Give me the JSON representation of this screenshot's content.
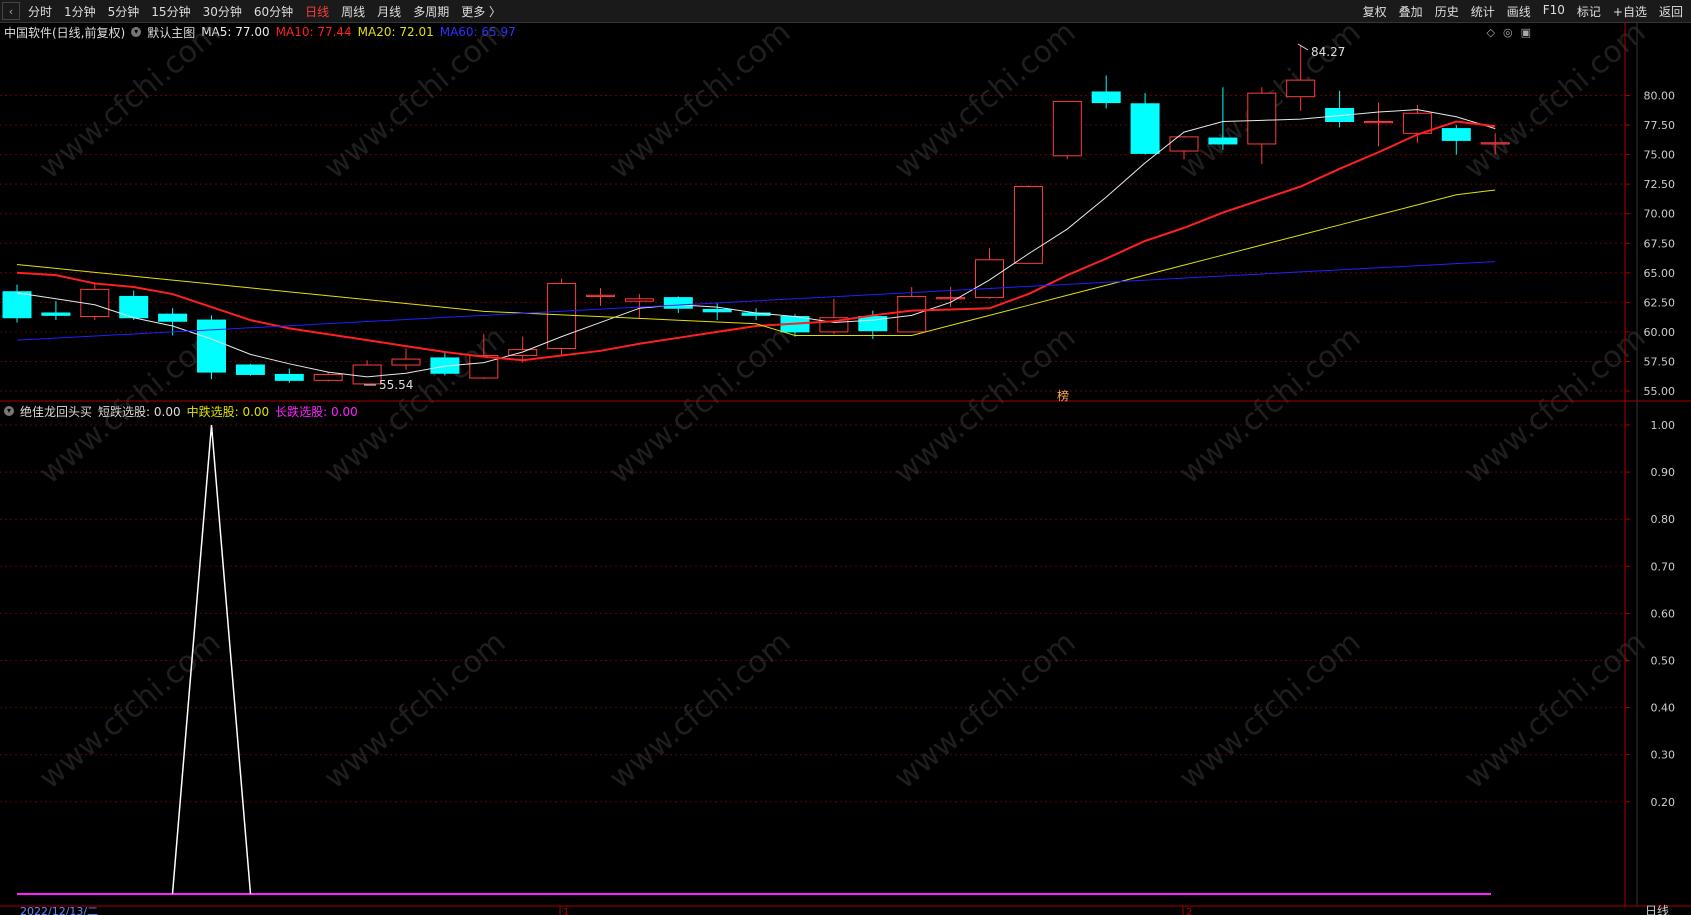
{
  "toolbar": {
    "periods": [
      "分时",
      "1分钟",
      "5分钟",
      "15分钟",
      "30分钟",
      "60分钟",
      "日线",
      "周线",
      "月线",
      "多周期",
      "更多 〉"
    ],
    "active_period": "日线",
    "right_items": [
      "复权",
      "叠加",
      "历史",
      "统计",
      "画线",
      "F10",
      "标记",
      "+自选",
      "返回"
    ]
  },
  "main_chart": {
    "title": "中国软件(日线,前复权)",
    "indicator_name": "默认主图",
    "ma5": "MA5: 77.00",
    "ma10": "MA10: 77.44",
    "ma20": "MA20: 72.01",
    "ma60": "MA60: 65.97",
    "high_label": "84.27",
    "low_label": "55.54",
    "marker_label": "榜",
    "y_ticks": [
      "80.00",
      "77.50",
      "75.00",
      "72.50",
      "70.00",
      "67.50",
      "65.00",
      "62.50",
      "60.00",
      "57.50",
      "55.00"
    ]
  },
  "sub_chart": {
    "name": "绝佳龙回头买",
    "short": "短跌选股: 0.00",
    "mid": "中跌选股: 0.00",
    "long": "长跌选股: 0.00",
    "y_ticks": [
      "1.00",
      "0.90",
      "0.80",
      "0.70",
      "0.60",
      "0.50",
      "0.40",
      "0.30",
      "0.20"
    ]
  },
  "bottom": {
    "date": "2022/12/13/二",
    "period_label": "日线",
    "month_marks": [
      "1",
      "2"
    ]
  },
  "colors": {
    "up": "#ff3c3c",
    "down": "#00ffff",
    "ma5": "#e8e8e8",
    "ma10": "#ff2020",
    "ma20": "#e0e000",
    "ma60": "#2020ff",
    "short": "#ffffff",
    "mid": "#e0e000",
    "long": "#ff20ff",
    "grid": "#6a0000"
  },
  "watermark": "www.cfchi.com",
  "chart_data": [
    {
      "type": "candlestick",
      "name": "中国软件(日线,前复权)",
      "ylim": [
        54,
        84.5
      ],
      "candles": [
        {
          "o": 63.4,
          "c": 61.2,
          "h": 64.0,
          "l": 60.8
        },
        {
          "o": 61.6,
          "c": 61.4,
          "h": 62.6,
          "l": 61.0
        },
        {
          "o": 61.3,
          "c": 63.6,
          "h": 64.2,
          "l": 61.0
        },
        {
          "o": 63.0,
          "c": 61.2,
          "h": 63.5,
          "l": 61.0
        },
        {
          "o": 61.5,
          "c": 60.9,
          "h": 62.0,
          "l": 59.7
        },
        {
          "o": 61.0,
          "c": 56.6,
          "h": 61.4,
          "l": 56.0
        },
        {
          "o": 57.2,
          "c": 56.4,
          "h": 57.3,
          "l": 56.3
        },
        {
          "o": 56.4,
          "c": 55.9,
          "h": 56.9,
          "l": 55.7
        },
        {
          "o": 55.9,
          "c": 56.4,
          "h": 56.6,
          "l": 55.8
        },
        {
          "o": 55.6,
          "c": 57.2,
          "h": 57.6,
          "l": 55.5
        },
        {
          "o": 57.2,
          "c": 57.7,
          "h": 58.6,
          "l": 56.8
        },
        {
          "o": 57.8,
          "c": 56.5,
          "h": 58.3,
          "l": 56.3
        },
        {
          "o": 56.1,
          "c": 58.0,
          "h": 59.8,
          "l": 56.0
        },
        {
          "o": 58.0,
          "c": 58.5,
          "h": 59.6,
          "l": 57.4
        },
        {
          "o": 58.6,
          "c": 64.1,
          "h": 64.5,
          "l": 58.0
        },
        {
          "o": 63.0,
          "c": 63.1,
          "h": 63.7,
          "l": 62.2
        },
        {
          "o": 62.6,
          "c": 62.8,
          "h": 63.2,
          "l": 61.2
        },
        {
          "o": 62.9,
          "c": 62.0,
          "h": 63.0,
          "l": 61.6
        },
        {
          "o": 61.9,
          "c": 61.7,
          "h": 62.4,
          "l": 61.0
        },
        {
          "o": 61.6,
          "c": 61.4,
          "h": 62.0,
          "l": 61.0
        },
        {
          "o": 61.3,
          "c": 60.0,
          "h": 61.5,
          "l": 59.6
        },
        {
          "o": 60.0,
          "c": 61.2,
          "h": 62.8,
          "l": 59.8
        },
        {
          "o": 61.3,
          "c": 60.1,
          "h": 61.8,
          "l": 59.4
        },
        {
          "o": 60.0,
          "c": 63.0,
          "h": 63.8,
          "l": 60.0
        },
        {
          "o": 62.9,
          "c": 62.9,
          "h": 63.8,
          "l": 62.1
        },
        {
          "o": 62.9,
          "c": 66.1,
          "h": 67.1,
          "l": 62.8
        },
        {
          "o": 65.8,
          "c": 72.3,
          "h": 72.4,
          "l": 65.8
        },
        {
          "o": 74.9,
          "c": 79.5,
          "h": 79.5,
          "l": 74.6
        },
        {
          "o": 80.3,
          "c": 79.4,
          "h": 81.7,
          "l": 78.9
        },
        {
          "o": 79.3,
          "c": 75.1,
          "h": 80.2,
          "l": 75.0
        },
        {
          "o": 75.3,
          "c": 76.5,
          "h": 76.6,
          "l": 74.6
        },
        {
          "o": 76.4,
          "c": 75.9,
          "h": 80.7,
          "l": 75.4
        },
        {
          "o": 75.9,
          "c": 80.2,
          "h": 80.7,
          "l": 74.2
        },
        {
          "o": 79.9,
          "c": 81.3,
          "h": 84.27,
          "l": 78.7
        },
        {
          "o": 78.9,
          "c": 77.8,
          "h": 80.4,
          "l": 77.3
        },
        {
          "o": 77.7,
          "c": 77.8,
          "h": 79.4,
          "l": 75.7
        },
        {
          "o": 76.8,
          "c": 78.5,
          "h": 79.2,
          "l": 76.0
        },
        {
          "o": 77.2,
          "c": 76.2,
          "h": 77.5,
          "l": 75.0
        },
        {
          "o": 76.0,
          "c": 76.0,
          "h": 76.8,
          "l": 75.0
        }
      ],
      "ma5": [
        63.3,
        62.8,
        62.3,
        61.2,
        60.5,
        59.4,
        58.1,
        57.3,
        56.6,
        56.2,
        56.5,
        57.1,
        57.4,
        58.3,
        59.6,
        60.8,
        62.0,
        62.3,
        62.1,
        61.6,
        61.3,
        60.8,
        61.0,
        61.4,
        62.5,
        64.4,
        66.6,
        68.7,
        71.4,
        74.3,
        76.9,
        77.8,
        77.9,
        78.0,
        78.3,
        78.6,
        78.8,
        78.2,
        77.2
      ],
      "ma10": [
        65.0,
        64.8,
        64.1,
        63.8,
        63.2,
        62.1,
        61.0,
        60.3,
        59.8,
        59.3,
        58.8,
        58.3,
        57.9,
        57.6,
        58.0,
        58.4,
        59.0,
        59.5,
        60.0,
        60.5,
        60.7,
        60.9,
        61.4,
        61.8,
        61.9,
        62.0,
        63.2,
        64.8,
        66.2,
        67.7,
        68.8,
        70.1,
        71.2,
        72.3,
        73.8,
        75.2,
        76.7,
        77.8,
        77.4
      ]
    },
    {
      "type": "line",
      "name": "绝佳龙回头买",
      "ylim": [
        0,
        1
      ],
      "short_spike": {
        "index": 5,
        "value": 1.0
      }
    }
  ]
}
